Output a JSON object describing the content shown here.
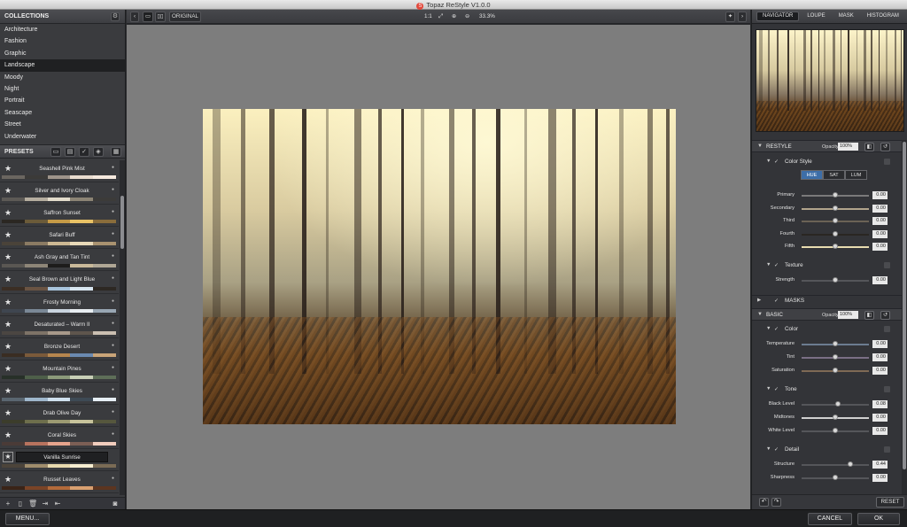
{
  "window": {
    "title": "Topaz ReStyle V1.0.0",
    "logo_glyph": "S"
  },
  "collections": {
    "header": "COLLECTIONS",
    "items": [
      "Architecture",
      "Fashion",
      "Graphic",
      "Landscape",
      "Moody",
      "Night",
      "Portrait",
      "Seascape",
      "Street",
      "Underwater"
    ],
    "selected": "Landscape"
  },
  "presets": {
    "header": "PRESETS",
    "selected": "Vanilla Sunrise",
    "items": [
      {
        "name": "Seashell Pink Mist",
        "colors": [
          "#6b6660",
          "#3b3a38",
          "#9e948a",
          "#e9dccf",
          "#f5e9de"
        ]
      },
      {
        "name": "Silver and Ivory Cloak",
        "colors": [
          "#5d5a56",
          "#b5ad9f",
          "#e3dccb",
          "#8c8475",
          "#3c3b39"
        ]
      },
      {
        "name": "Saffron Sunset",
        "colors": [
          "#2b2722",
          "#6b5b39",
          "#c59a46",
          "#e9c265",
          "#8a6d3b"
        ]
      },
      {
        "name": "Safari Buff",
        "colors": [
          "#4a4339",
          "#8b7b63",
          "#cdb893",
          "#e8d9b8",
          "#a99270"
        ]
      },
      {
        "name": "Ash Gray and Tan Tint",
        "colors": [
          "#5a5753",
          "#8e8678",
          "#1d1c1b",
          "#c9b99a",
          "#b0a796"
        ]
      },
      {
        "name": "Seal Brown and Light Blue",
        "colors": [
          "#3b2e24",
          "#6a5443",
          "#a8c4dc",
          "#d8e6f0",
          "#2d2823"
        ]
      },
      {
        "name": "Frosty Morning",
        "colors": [
          "#3f4650",
          "#7a8896",
          "#c9d4de",
          "#e9eef2",
          "#98a6b3"
        ]
      },
      {
        "name": "Desaturated – Warm II",
        "colors": [
          "#4b4642",
          "#7e7367",
          "#a8998a",
          "#5e554d",
          "#cbbfb1"
        ]
      },
      {
        "name": "Bronze Desert",
        "colors": [
          "#3a2d22",
          "#7b5a3a",
          "#b6864e",
          "#6b8ab1",
          "#c9a478"
        ]
      },
      {
        "name": "Mountain Pines",
        "colors": [
          "#273028",
          "#4e5f49",
          "#8c9a7a",
          "#c8cfb6",
          "#5e6e58"
        ]
      },
      {
        "name": "Baby Blue Skies",
        "colors": [
          "#5a6670",
          "#9fb7cc",
          "#cfe0ee",
          "#3e4a55",
          "#e7eff5"
        ]
      },
      {
        "name": "Drab Olive Day",
        "colors": [
          "#3c3d2b",
          "#6e6f4c",
          "#9c9a72",
          "#c7c39b",
          "#56573d"
        ]
      },
      {
        "name": "Coral Skies",
        "colors": [
          "#4a3b37",
          "#b8735e",
          "#e6a48c",
          "#7c5f55",
          "#f1cdbd"
        ]
      },
      {
        "name": "Vanilla Sunrise",
        "colors": [
          "#4c443a",
          "#a08d6c",
          "#e8d9ad",
          "#f6edd0",
          "#7a6b55"
        ]
      },
      {
        "name": "Russet Leaves",
        "colors": [
          "#3a2417",
          "#7a4427",
          "#b26a3a",
          "#d9a070",
          "#5c3520"
        ]
      }
    ]
  },
  "toolbar": {
    "original": "ORIGINAL",
    "ratio": "1:1",
    "zoom": "33.3%"
  },
  "tabs": {
    "items": [
      "NAVIGATOR",
      "LOUPE",
      "MASK",
      "HISTOGRAM"
    ],
    "active": "NAVIGATOR"
  },
  "restyle": {
    "title": "RESTYLE",
    "opacity_label": "Opacity:",
    "opacity": "100%",
    "color_style": {
      "title": "Color Style",
      "modes": [
        "HUE",
        "SAT",
        "LUM"
      ],
      "active_mode": "HUE",
      "sliders": [
        {
          "label": "Primary",
          "value": "0.00",
          "pos": 0.5,
          "track": "#7a7a7a"
        },
        {
          "label": "Secondary",
          "value": "0.00",
          "pos": 0.5,
          "track": "#b2a58c"
        },
        {
          "label": "Third",
          "value": "0.00",
          "pos": 0.5,
          "track": "#6b6255"
        },
        {
          "label": "Fourth",
          "value": "0.00",
          "pos": 0.5,
          "track": "#2a2622"
        },
        {
          "label": "Fifth",
          "value": "0.00",
          "pos": 0.5,
          "track": "#e8dcb0"
        }
      ]
    },
    "texture": {
      "title": "Texture",
      "sliders": [
        {
          "label": "Strength",
          "value": "0.00",
          "pos": 0.5,
          "track": "#55565a"
        }
      ]
    },
    "masks": {
      "title": "MASKS"
    }
  },
  "basic": {
    "title": "BASIC",
    "opacity_label": "Opacity:",
    "opacity": "100%",
    "color": {
      "title": "Color",
      "sliders": [
        {
          "label": "Temperature",
          "value": "0.00",
          "pos": 0.5,
          "track": "#6c7c90"
        },
        {
          "label": "Tint",
          "value": "0.00",
          "pos": 0.5,
          "track": "#7a6f85"
        },
        {
          "label": "Saturation",
          "value": "0.00",
          "pos": 0.5,
          "track": "#7f6a55"
        }
      ]
    },
    "tone": {
      "title": "Tone",
      "sliders": [
        {
          "label": "Black Level",
          "value": "0.08",
          "pos": 0.54,
          "track": "#55565a"
        },
        {
          "label": "Midtones",
          "value": "0.00",
          "pos": 0.5,
          "track": "#d0d0d0"
        },
        {
          "label": "White Level",
          "value": "0.00",
          "pos": 0.5,
          "track": "#55565a"
        }
      ]
    },
    "detail": {
      "title": "Detail",
      "sliders": [
        {
          "label": "Structure",
          "value": "0.44",
          "pos": 0.72,
          "track": "#55565a"
        },
        {
          "label": "Sharpness",
          "value": "0.00",
          "pos": 0.5,
          "track": "#55565a"
        }
      ]
    }
  },
  "footer": {
    "reset": "RESET",
    "menu": "MENU...",
    "cancel": "CANCEL",
    "ok": "OK"
  }
}
